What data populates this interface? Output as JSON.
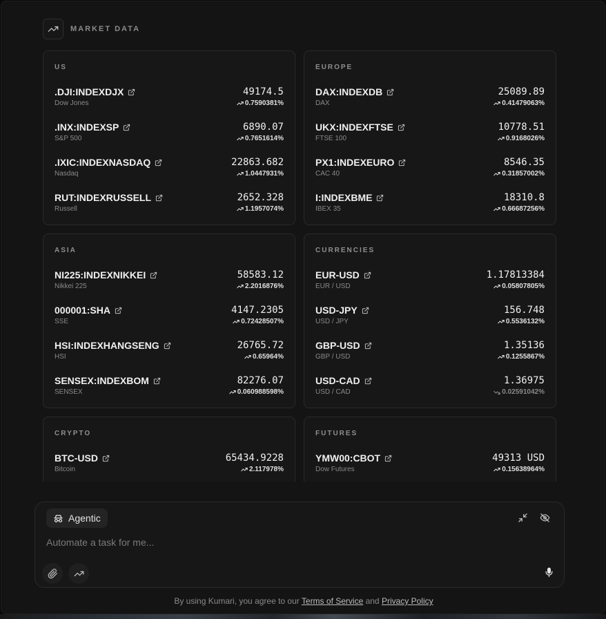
{
  "header": {
    "title": "MARKET DATA",
    "icon": "trending-up-icon"
  },
  "sections": [
    {
      "title": "US",
      "rows": [
        {
          "symbol": ".DJI:INDEXDJX",
          "name": "Dow Jones",
          "price": "49174.5",
          "change": "0.7590381%",
          "dir": "up"
        },
        {
          "symbol": ".INX:INDEXSP",
          "name": "S&P 500",
          "price": "6890.07",
          "change": "0.7651614%",
          "dir": "up"
        },
        {
          "symbol": ".IXIC:INDEXNASDAQ",
          "name": "Nasdaq",
          "price": "22863.682",
          "change": "1.0447931%",
          "dir": "up"
        },
        {
          "symbol": "RUT:INDEXRUSSELL",
          "name": "Russell",
          "price": "2652.328",
          "change": "1.1957074%",
          "dir": "up"
        }
      ]
    },
    {
      "title": "EUROPE",
      "rows": [
        {
          "symbol": "DAX:INDEXDB",
          "name": "DAX",
          "price": "25089.89",
          "change": "0.41479063%",
          "dir": "up"
        },
        {
          "symbol": "UKX:INDEXFTSE",
          "name": "FTSE 100",
          "price": "10778.51",
          "change": "0.9168026%",
          "dir": "up"
        },
        {
          "symbol": "PX1:INDEXEURO",
          "name": "CAC 40",
          "price": "8546.35",
          "change": "0.31857002%",
          "dir": "up"
        },
        {
          "symbol": "I:INDEXBME",
          "name": "IBEX 35",
          "price": "18310.8",
          "change": "0.66687256%",
          "dir": "up"
        }
      ]
    },
    {
      "title": "ASIA",
      "rows": [
        {
          "symbol": "NI225:INDEXNIKKEI",
          "name": "Nikkei 225",
          "price": "58583.12",
          "change": "2.2016876%",
          "dir": "up"
        },
        {
          "symbol": "000001:SHA",
          "name": "SSE",
          "price": "4147.2305",
          "change": "0.72428507%",
          "dir": "up"
        },
        {
          "symbol": "HSI:INDEXHANGSENG",
          "name": "HSI",
          "price": "26765.72",
          "change": "0.65964%",
          "dir": "up"
        },
        {
          "symbol": "SENSEX:INDEXBOM",
          "name": "SENSEX",
          "price": "82276.07",
          "change": "0.060988598%",
          "dir": "up"
        }
      ]
    },
    {
      "title": "CURRENCIES",
      "rows": [
        {
          "symbol": "EUR-USD",
          "name": "EUR / USD",
          "price": "1.17813384",
          "change": "0.05807805%",
          "dir": "up"
        },
        {
          "symbol": "USD-JPY",
          "name": "USD / JPY",
          "price": "156.748",
          "change": "0.5536132%",
          "dir": "up"
        },
        {
          "symbol": "GBP-USD",
          "name": "GBP / USD",
          "price": "1.35136",
          "change": "0.1255867%",
          "dir": "up"
        },
        {
          "symbol": "USD-CAD",
          "name": "USD / CAD",
          "price": "1.36975",
          "change": "0.02591042%",
          "dir": "down"
        }
      ]
    },
    {
      "title": "CRYPTO",
      "rows": [
        {
          "symbol": "BTC-USD",
          "name": "Bitcoin",
          "price": "65434.9228",
          "change": "2.117978%",
          "dir": "up"
        }
      ]
    },
    {
      "title": "FUTURES",
      "rows": [
        {
          "symbol": "YMW00:CBOT",
          "name": "Dow Futures",
          "price": "49313 USD",
          "change": "0.15638964%",
          "dir": "up"
        }
      ]
    }
  ],
  "composer": {
    "mode_label": "Agentic",
    "placeholder": "Automate a task for me..."
  },
  "footer": {
    "prefix": "By using Kumari, you agree to our ",
    "terms": "Terms of Service",
    "and": " and ",
    "privacy": "Privacy Policy"
  }
}
